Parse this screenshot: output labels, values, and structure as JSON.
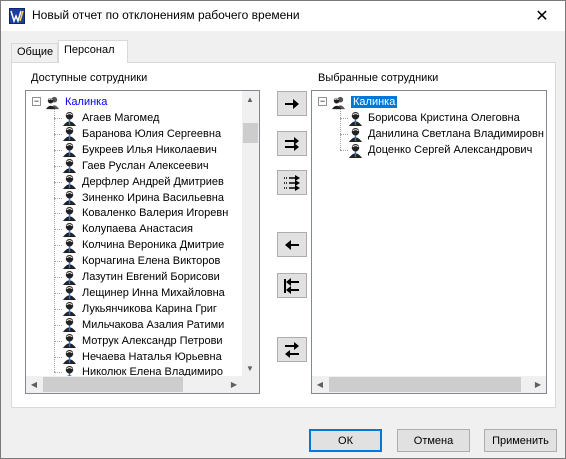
{
  "window": {
    "title": "Новый отчет по отклонениям рабочего времени",
    "close_glyph": "✕"
  },
  "tabs": [
    {
      "label": "Общие",
      "active": false
    },
    {
      "label": "Персонал",
      "active": true
    }
  ],
  "available": {
    "label": "Доступные сотрудники",
    "root": "Калинка",
    "items": [
      "Агаев Магомед",
      "Баранова Юлия Сергеевна",
      "Букреев Илья Николаевич",
      "Гаев Руслан Алексеевич",
      "Дерфлер Андрей Дмитриев",
      "Зиненко Ирина Васильевна",
      "Коваленко Валерия Игоревн",
      "Колупаева Анастасия",
      "Колчина Вероника Дмитрие",
      "Корчагина Елена Викторов",
      "Лазутин Евгений Борисови",
      "Лещинер Инна Михайловна",
      "Лукьянчикова Карина Григ",
      "Мильчакова Азалия Ратими",
      "Мотрук Александр Петрови",
      "Нечаева Наталья Юрьевна",
      "Николюк Елена Владимиро"
    ]
  },
  "selected": {
    "label": "Выбранные сотрудники",
    "root": "Калинка",
    "items": [
      "Борисова Кристина Олеговна",
      "Данилина Светлана Владимировн",
      "Доценко Сергей Александрович"
    ]
  },
  "transfer_buttons": [
    {
      "name": "add-one-button",
      "icon": "arrow-right-icon"
    },
    {
      "name": "add-double-button",
      "icon": "double-arrow-right-icon"
    },
    {
      "name": "add-all-button",
      "icon": "add-all-arrow-icon"
    },
    {
      "name": "remove-one-button",
      "icon": "arrow-left-icon"
    },
    {
      "name": "remove-all-button",
      "icon": "double-arrow-left-icon"
    },
    {
      "name": "swap-button",
      "icon": "swap-arrows-icon"
    }
  ],
  "buttons": {
    "ok": "ОК",
    "cancel": "Отмена",
    "apply": "Применить"
  },
  "colors": {
    "accent": "#0078d7",
    "root_text": "#0000ff"
  }
}
